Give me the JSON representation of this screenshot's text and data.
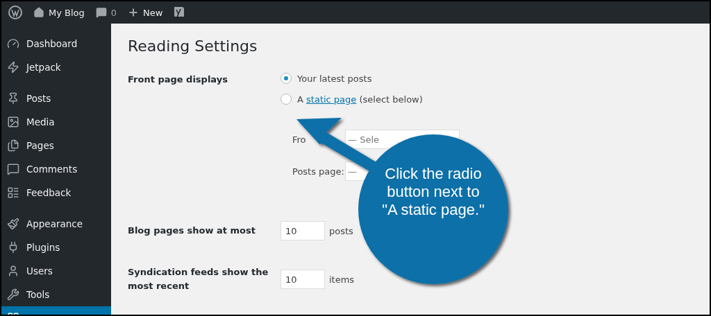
{
  "toolbar": {
    "items": [
      {
        "kind": "logo"
      },
      {
        "kind": "site",
        "label": "My Blog"
      },
      {
        "kind": "comments",
        "label": "0"
      },
      {
        "kind": "new",
        "label": "New"
      },
      {
        "kind": "seo"
      }
    ]
  },
  "sidebar": {
    "groups": [
      [
        {
          "kind": "dashboard",
          "label": "Dashboard",
          "selected": false
        },
        {
          "kind": "jetpack",
          "label": "Jetpack",
          "selected": false
        }
      ],
      [
        {
          "kind": "posts",
          "label": "Posts",
          "selected": false
        },
        {
          "kind": "media",
          "label": "Media",
          "selected": false
        },
        {
          "kind": "pages",
          "label": "Pages",
          "selected": false
        },
        {
          "kind": "comments",
          "label": "Comments",
          "selected": false
        },
        {
          "kind": "feedback",
          "label": "Feedback",
          "selected": false
        }
      ],
      [
        {
          "kind": "appearance",
          "label": "Appearance",
          "selected": false
        },
        {
          "kind": "plugins",
          "label": "Plugins",
          "selected": false
        },
        {
          "kind": "users",
          "label": "Users",
          "selected": false
        },
        {
          "kind": "tools",
          "label": "Tools",
          "selected": false
        },
        {
          "kind": "settings",
          "selected": true
        }
      ]
    ]
  },
  "page": {
    "title": "Reading Settings",
    "front_page": {
      "label": "Front page displays",
      "options": [
        {
          "prefix": "Your latest posts",
          "selected": true
        },
        {
          "prefix": "A",
          "link": "static page",
          "suffix": "(select below)",
          "selected": false
        }
      ],
      "selects": [
        {
          "label": "Fro",
          "value": "— Sele"
        },
        {
          "label": "Posts page:",
          "value": "—"
        }
      ]
    },
    "fields": [
      {
        "label": "Blog pages show at most",
        "value": "10",
        "unit": "posts"
      },
      {
        "label": "Syndication feeds show the most recent",
        "value": "10",
        "unit": "items"
      }
    ]
  },
  "callout": {
    "text": "Click the radio button next to \"A static page.\""
  }
}
